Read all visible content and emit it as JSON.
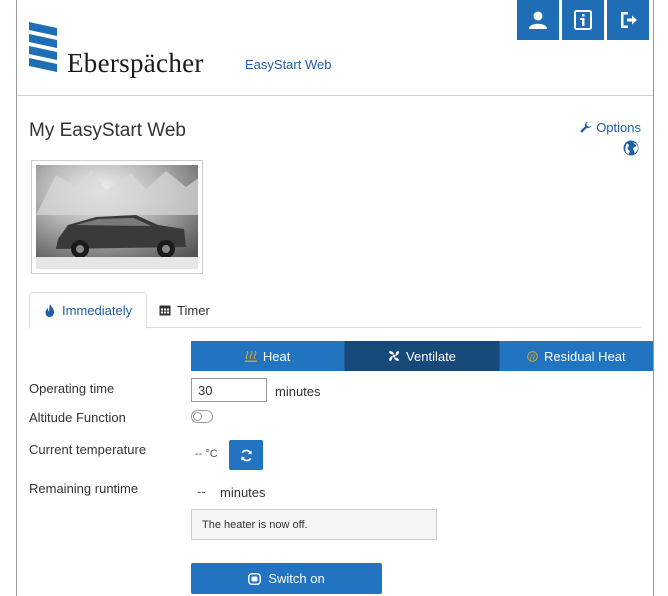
{
  "header": {
    "brand": "Eberspächer",
    "app_link": "EasyStart Web",
    "icons": [
      "user-icon",
      "info-card-icon",
      "logout-icon"
    ]
  },
  "page": {
    "title": "My EasyStart Web",
    "options_label": "Options"
  },
  "tabs": [
    {
      "label": "Immediately",
      "icon": "flame-icon",
      "active": true
    },
    {
      "label": "Timer",
      "icon": "calendar-icon",
      "active": false
    }
  ],
  "modes": [
    {
      "label": "Heat",
      "icon": "heat-icon",
      "active": false
    },
    {
      "label": "Ventilate",
      "icon": "fan-icon",
      "active": true
    },
    {
      "label": "Residual Heat",
      "icon": "residual-heat-icon",
      "active": false
    }
  ],
  "form": {
    "operating_time_label": "Operating time",
    "operating_time_value": "30",
    "operating_time_unit": "minutes",
    "altitude_label": "Altitude Function",
    "altitude_on": false,
    "current_temp_label": "Current temperature",
    "current_temp_value": "-- °C",
    "remaining_label": "Remaining runtime",
    "remaining_value": "--",
    "remaining_unit": "minutes",
    "status_text": "The heater is now off.",
    "switch_label": "Switch on"
  },
  "colors": {
    "primary": "#2274c0",
    "primary_active": "#174a7a",
    "link": "#1f5fa6"
  }
}
